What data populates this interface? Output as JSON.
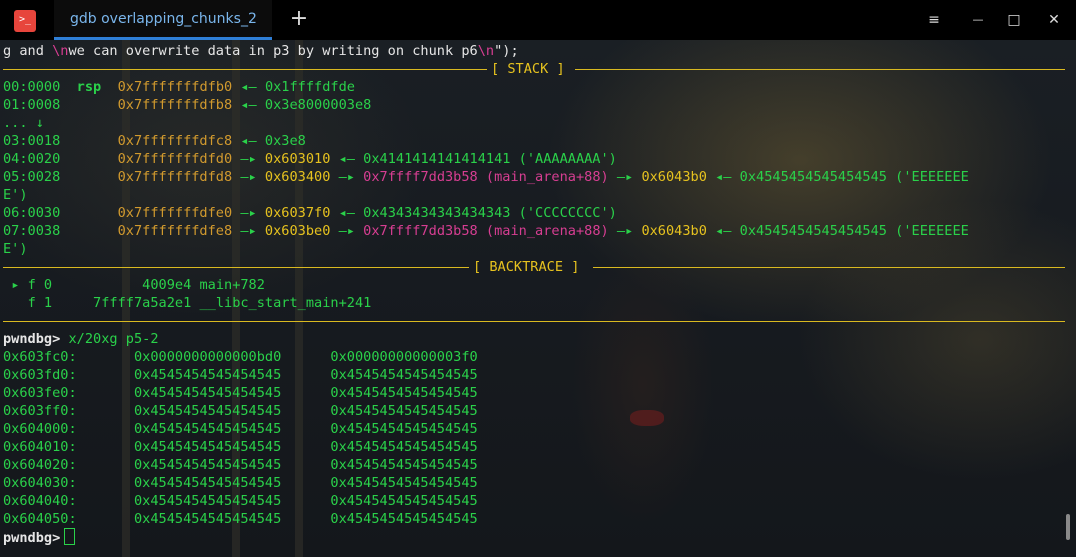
{
  "window": {
    "tab_title": "gdb overlapping_chunks_2",
    "app_icon_glyph": ">_",
    "new_tab_glyph": "+",
    "controls": {
      "menu": "≡",
      "minimize": "—",
      "maximize": "□",
      "close": "✕"
    }
  },
  "colors": {
    "green": "#2ad14a",
    "yellow": "#e6c21f",
    "orange": "#d19a2e",
    "pink": "#d73e92",
    "tab_accent": "#2f7fd7",
    "title_icon": "#e7453c"
  },
  "source_line": {
    "a": "g and ",
    "esc1": "\\n",
    "b": "we can overwrite data in p3 by writing on chunk p6",
    "esc2": "\\n",
    "c": "\");"
  },
  "stack": {
    "header": "[ STACK ]",
    "rows": [
      {
        "idx": "00:0000",
        "reg": "rsp",
        "addr": "0x7fffffffdfb0",
        "a1": "◂—",
        "v1": "0x1ffffdfde"
      },
      {
        "idx": "01:0008",
        "addr": "0x7fffffffdfb8",
        "a1": "◂—",
        "v1": "0x3e8000003e8"
      },
      {
        "idx": "... ↓"
      },
      {
        "idx": "03:0018",
        "addr": "0x7fffffffdfc8",
        "a1": "◂—",
        "v1": "0x3e8"
      },
      {
        "idx": "04:0020",
        "addr": "0x7fffffffdfd0",
        "a1": "—▸",
        "v1": "0x603010",
        "a2": "◂—",
        "v2": "0x4141414141414141 ('AAAAAAAA')"
      },
      {
        "idx": "05:0028",
        "addr": "0x7fffffffdfd8",
        "a1": "—▸",
        "v1": "0x603400",
        "a2": "—▸",
        "v2": "0x7ffff7dd3b58",
        "sym": "(main_arena+88)",
        "a3": "—▸",
        "v3": "0x6043b0",
        "a4": "◂—",
        "v4": "0x4545454545454545 ('EEEEEEE",
        "cont": "E')"
      },
      {
        "idx": "06:0030",
        "addr": "0x7fffffffdfe0",
        "a1": "—▸",
        "v1": "0x6037f0",
        "a2": "◂—",
        "v2": "0x4343434343434343 ('CCCCCCCC')"
      },
      {
        "idx": "07:0038",
        "addr": "0x7fffffffdfe8",
        "a1": "—▸",
        "v1": "0x603be0",
        "a2": "—▸",
        "v2": "0x7ffff7dd3b58",
        "sym": "(main_arena+88)",
        "a3": "—▸",
        "v3": "0x6043b0",
        "a4": "◂—",
        "v4": "0x4545454545454545 ('EEEEEEE",
        "cont": "E')"
      }
    ]
  },
  "backtrace": {
    "header": "[ BACKTRACE ]",
    "frames": [
      {
        "marker": "▸",
        "label": "f 0",
        "addr": "4009e4",
        "sym": "main+782"
      },
      {
        "marker": "",
        "label": "f 1",
        "addr": "7ffff7a5a2e1",
        "sym": "__libc_start_main+241"
      }
    ]
  },
  "prompt": "pwndbg>",
  "command": "x/20xg p5-2",
  "memory": [
    {
      "addr": "0x603fc0:",
      "q1": "0x0000000000000bd0",
      "q2": "0x00000000000003f0"
    },
    {
      "addr": "0x603fd0:",
      "q1": "0x4545454545454545",
      "q2": "0x4545454545454545"
    },
    {
      "addr": "0x603fe0:",
      "q1": "0x4545454545454545",
      "q2": "0x4545454545454545"
    },
    {
      "addr": "0x603ff0:",
      "q1": "0x4545454545454545",
      "q2": "0x4545454545454545"
    },
    {
      "addr": "0x604000:",
      "q1": "0x4545454545454545",
      "q2": "0x4545454545454545"
    },
    {
      "addr": "0x604010:",
      "q1": "0x4545454545454545",
      "q2": "0x4545454545454545"
    },
    {
      "addr": "0x604020:",
      "q1": "0x4545454545454545",
      "q2": "0x4545454545454545"
    },
    {
      "addr": "0x604030:",
      "q1": "0x4545454545454545",
      "q2": "0x4545454545454545"
    },
    {
      "addr": "0x604040:",
      "q1": "0x4545454545454545",
      "q2": "0x4545454545454545"
    },
    {
      "addr": "0x604050:",
      "q1": "0x4545454545454545",
      "q2": "0x4545454545454545"
    }
  ]
}
